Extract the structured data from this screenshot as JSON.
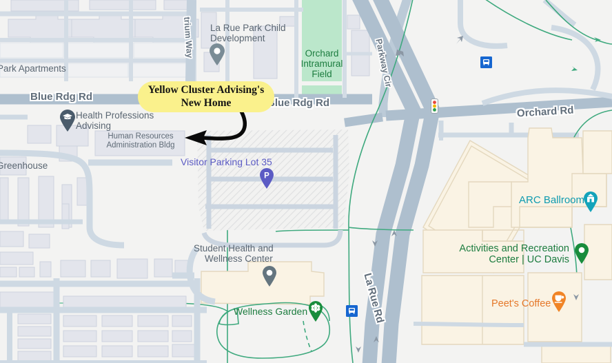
{
  "app": {
    "type": "map-screenshot",
    "provider_style": "google-maps"
  },
  "annotation": {
    "callout": {
      "line1": "Yellow Cluster Advising's",
      "line2": "New Home",
      "color": "#FAF18C",
      "text_color": "#141414"
    },
    "arrow": {
      "color": "#0A0A0A",
      "points_to": "Human Resources Administration Bldg"
    }
  },
  "roads": [
    {
      "name": "Blue Rdg Rd",
      "size": "major"
    },
    {
      "name": "Blue Rdg Rd",
      "size": "major"
    },
    {
      "name": "Orchard Rd",
      "size": "major"
    },
    {
      "name": "La Rue Rd",
      "size": "major"
    },
    {
      "name": "Parkway Cir",
      "size": "minor"
    },
    {
      "name": "trium Way",
      "size": "minor"
    }
  ],
  "road_labels": {
    "blue_rdg_left": "Blue Rdg Rd",
    "blue_rdg_right": "Blue Rdg Rd",
    "orchard": "Orchard Rd",
    "la_rue": "La Rue Rd",
    "parkway": "Parkway Cir",
    "atrium": "trium Way"
  },
  "places": [
    {
      "id": "park_apartments",
      "label": "Park Apartments",
      "type": "residential",
      "color": "#5A6672",
      "has_pin": false
    },
    {
      "id": "la_rue_park_child",
      "label": "La Rue Park Child\nDevelopment",
      "type": "poi",
      "color": "#5A6672",
      "has_pin": true,
      "pin_color": "#7A8C96",
      "pin_icon": "dot-pin-icon"
    },
    {
      "id": "orchard_field",
      "label": "Orchard\nIntramural\nField",
      "type": "park",
      "color": "#1C7C3F",
      "has_pin": false
    },
    {
      "id": "health_professions",
      "label": "Health Professions\nAdvising",
      "type": "poi",
      "color": "#5A6672",
      "has_pin": true,
      "pin_color": "#4A5B6B",
      "pin_icon": "graduation-cap-icon"
    },
    {
      "id": "hr_admin",
      "label": "Human Resources\nAdministration Bldg",
      "type": "building",
      "color": "#5F6B77",
      "has_pin": false
    },
    {
      "id": "greenhouse",
      "label": "Greenhouse",
      "type": "building",
      "color": "#5A6672",
      "has_pin": false
    },
    {
      "id": "visitor_parking_35",
      "label": "Visitor Parking Lot 35",
      "type": "parking",
      "color": "#5B5BC4",
      "has_pin": true,
      "pin_color": "#5B5BC4",
      "pin_icon": "parking-p-icon"
    },
    {
      "id": "student_health",
      "label": "Student Health and\nWellness Center",
      "type": "poi",
      "color": "#5A6672",
      "has_pin": true,
      "pin_color": "#64757F",
      "pin_icon": "dot-pin-icon"
    },
    {
      "id": "wellness_garden",
      "label": "Wellness Garden",
      "type": "garden",
      "color": "#1C7C3F",
      "has_pin": true,
      "pin_color": "#188C3C",
      "pin_icon": "flower-icon"
    },
    {
      "id": "arc_ballroom",
      "label": "ARC Ballroom",
      "type": "poi",
      "color": "#0E9BB0",
      "has_pin": true,
      "pin_color": "#13A3BA",
      "pin_icon": "landmark-icon"
    },
    {
      "id": "arc_center",
      "label": "Activities and Recreation\nCenter | UC Davis",
      "type": "poi",
      "color": "#1C7C3F",
      "has_pin": true,
      "pin_color": "#188C3C",
      "pin_icon": "dot-pin-icon"
    },
    {
      "id": "peets_coffee",
      "label": "Peet's Coffee",
      "type": "cafe",
      "color": "#E5782A",
      "has_pin": true,
      "pin_color": "#F08426",
      "pin_icon": "coffee-cup-icon"
    }
  ],
  "place_labels": {
    "park_apartments": "Park Apartments",
    "la_rue_park_child_l1": "La Rue Park Child",
    "la_rue_park_child_l2": "Development",
    "orchard_field_l1": "Orchard",
    "orchard_field_l2": "Intramural",
    "orchard_field_l3": "Field",
    "health_professions_l1": "Health Professions",
    "health_professions_l2": "Advising",
    "hr_admin_l1": "Human Resources",
    "hr_admin_l2": "Administration Bldg",
    "greenhouse": "Greenhouse",
    "visitor_parking": "Visitor Parking Lot 35",
    "student_health_l1": "Student Health and",
    "student_health_l2": "Wellness Center",
    "wellness_garden": "Wellness Garden",
    "arc_ballroom": "ARC Ballroom",
    "arc_center_l1": "Activities and Recreation",
    "arc_center_l2": "Center | UC Davis",
    "peets_coffee": "Peet's Coffee"
  },
  "transit": [
    {
      "id": "bus_stop_north",
      "type": "bus-stop",
      "color": "#1666D0"
    },
    {
      "id": "bus_stop_south",
      "type": "bus-stop",
      "color": "#1666D0"
    }
  ],
  "signals": [
    {
      "id": "traffic_signal",
      "type": "traffic-light",
      "lights": [
        "#E8453C",
        "#F3B700",
        "#2C9E4B"
      ]
    }
  ],
  "colors": {
    "land": "#F3F3F2",
    "road_fill": "#AEBFCE",
    "road_minor": "#CED9E3",
    "building_gray": "#E3E5EC",
    "building_gray_edge": "#CDD2DE",
    "building_beige": "#FAF3E4",
    "building_beige_edge": "#E4D8BE",
    "park_green": "#BBE7CB",
    "bike_path": "#3EA97E",
    "parking_hatch": "#E9E9EA"
  }
}
